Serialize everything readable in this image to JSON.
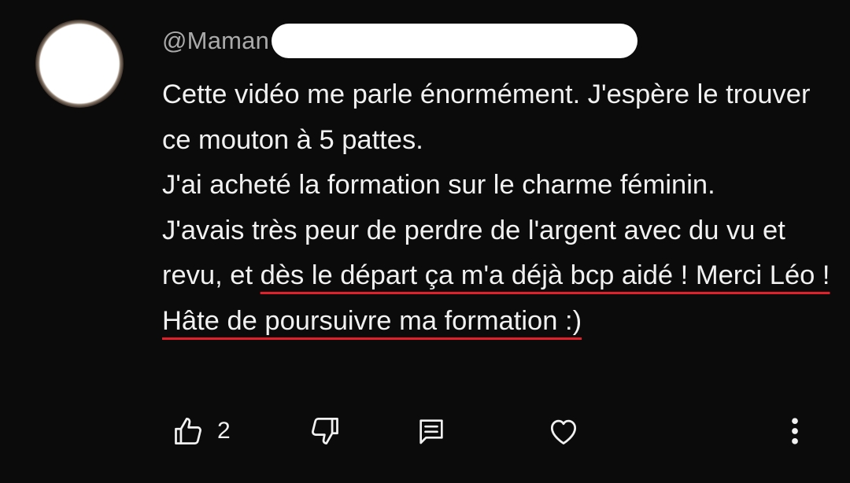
{
  "comment": {
    "username_prefix": "@Maman",
    "text_intro": "Cette vidéo me parle énormément. J'espère le trouver ce mouton à 5 pattes.",
    "text_line2": "J'ai acheté la formation sur le charme féminin.",
    "text_plain": "J'avais très peur de perdre de l'argent avec du vu et revu, et ",
    "text_underlined": "dès le départ ça m'a déjà bcp aidé ! Merci Léo ! Hâte de poursuivre ma formation :)"
  },
  "actions": {
    "like_count": "2"
  },
  "colors": {
    "background": "#0b0b0b",
    "text": "#f1f1f1",
    "username": "#aaaaaa",
    "underline": "#e3202a"
  },
  "icons": [
    "thumbs-up-icon",
    "thumbs-down-icon",
    "reply-icon",
    "heart-icon",
    "more-vertical-icon"
  ]
}
